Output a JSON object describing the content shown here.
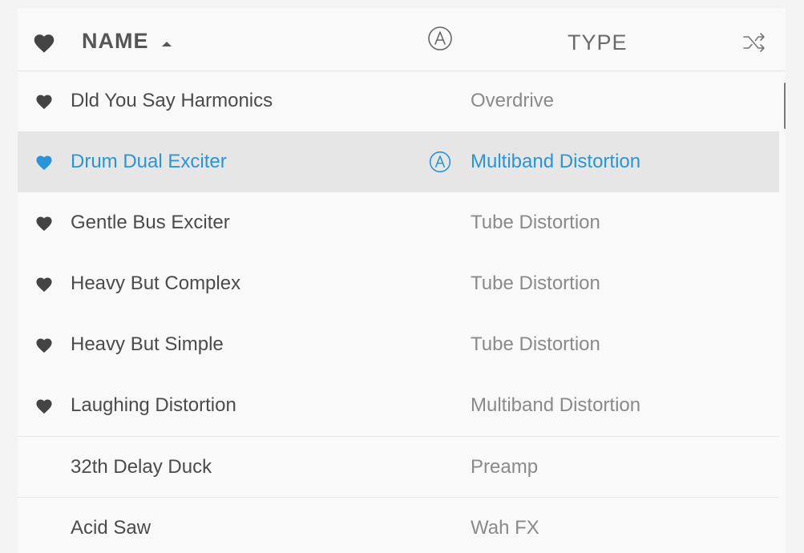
{
  "header": {
    "name_label": "NAME",
    "type_label": "TYPE",
    "sort_direction": "ascending",
    "favorite_icon": "heart-icon",
    "author_icon": "circled-a-icon",
    "shuffle_icon": "shuffle-icon"
  },
  "colors": {
    "accent": "#2a95d6",
    "text_primary": "#4b4b4b",
    "text_secondary": "#8a8a8a",
    "selected_bg": "#e6e6e6",
    "heart": "#444444"
  },
  "rows": [
    {
      "name": "Dld You Say Harmonics",
      "type": "Overdrive",
      "favorite": true,
      "selected": false,
      "factory": false
    },
    {
      "name": "Drum Dual Exciter",
      "type": "Multiband Distortion",
      "favorite": true,
      "selected": true,
      "factory": true
    },
    {
      "name": "Gentle Bus Exciter",
      "type": "Tube Distortion",
      "favorite": true,
      "selected": false,
      "factory": false
    },
    {
      "name": "Heavy But Complex",
      "type": "Tube Distortion",
      "favorite": true,
      "selected": false,
      "factory": false
    },
    {
      "name": "Heavy But Simple",
      "type": "Tube Distortion",
      "favorite": true,
      "selected": false,
      "factory": false
    },
    {
      "name": "Laughing Distortion",
      "type": "Multiband Distortion",
      "favorite": true,
      "selected": false,
      "factory": false
    },
    {
      "name": "32th Delay Duck",
      "type": "Preamp",
      "favorite": false,
      "selected": false,
      "factory": false
    },
    {
      "name": "Acid Saw",
      "type": "Wah FX",
      "favorite": false,
      "selected": false,
      "factory": false
    }
  ]
}
